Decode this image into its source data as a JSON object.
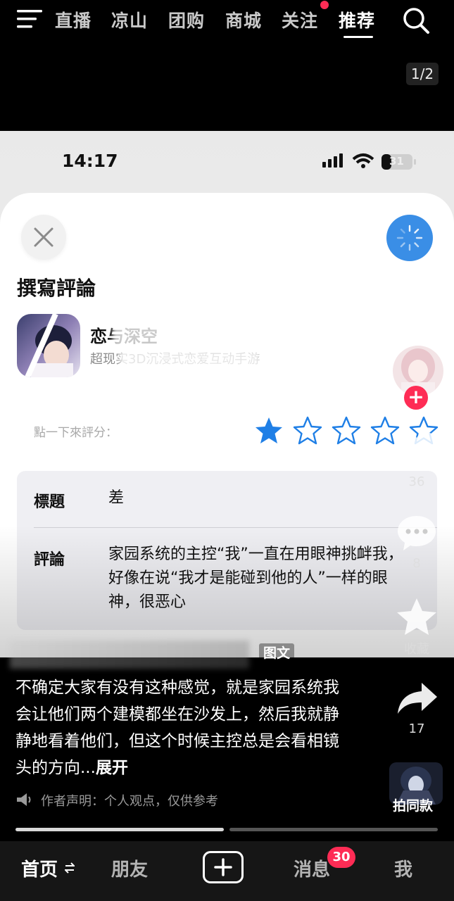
{
  "top_nav": {
    "tabs": [
      "直播",
      "凉山",
      "团购",
      "商城",
      "关注",
      "推荐"
    ],
    "active_tab": "推荐",
    "follow_has_dot": true
  },
  "page_indicator": "1/2",
  "embedded_screen": {
    "status_time": "14:17",
    "battery_level": "31",
    "sheet_title": "撰寫評論",
    "app_name": "恋与深空",
    "app_subtitle": "超现实3D沉浸式恋爱互动手游",
    "rating_prompt": "點一下來評分：",
    "rating": {
      "filled": 1,
      "total": 5
    },
    "form": {
      "title_label": "標題",
      "title_value": "差",
      "review_label": "評論",
      "review_value": "家园系统的主控“我”一直在用眼神挑衅我，好像在说“我才是能碰到他的人”一样的眼神，很恶心"
    }
  },
  "actions": {
    "like_count": "36",
    "comment_count": "8",
    "favorite_label": "收藏",
    "share_count": "17",
    "follow_plus": "+"
  },
  "caption": {
    "tag": "图文",
    "text": "不确定大家有没有这种感觉，就是家园系统我会让他们两个建模都坐在沙发上，然后我就静静地看着他们，但这个时候主控总是会看相镜头的方向...",
    "expand": "展开",
    "disclaimer": "作者声明：个人观点，仅供参考",
    "same_style": "拍同款"
  },
  "progress": {
    "current": 1,
    "total": 2
  },
  "bottom_nav": {
    "home": "首页",
    "friends": "朋友",
    "messages": "消息",
    "messages_badge": "30",
    "me": "我"
  },
  "colors": {
    "accent_red": "#fe2c55",
    "ios_blue": "#3a8ee6",
    "star_blue": "#1f7fe6"
  }
}
